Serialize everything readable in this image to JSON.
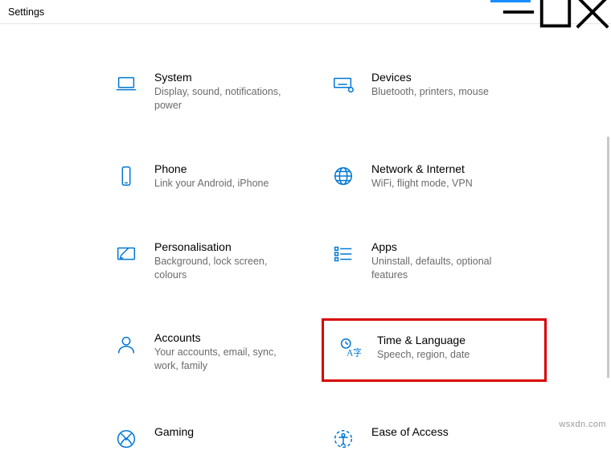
{
  "window": {
    "title": "Settings"
  },
  "categories": {
    "system": {
      "title": "System",
      "desc": "Display, sound, notifications, power"
    },
    "devices": {
      "title": "Devices",
      "desc": "Bluetooth, printers, mouse"
    },
    "phone": {
      "title": "Phone",
      "desc": "Link your Android, iPhone"
    },
    "network": {
      "title": "Network & Internet",
      "desc": "WiFi, flight mode, VPN"
    },
    "personal": {
      "title": "Personalisation",
      "desc": "Background, lock screen, colours"
    },
    "apps": {
      "title": "Apps",
      "desc": "Uninstall, defaults, optional features"
    },
    "accounts": {
      "title": "Accounts",
      "desc": "Your accounts, email, sync, work, family"
    },
    "timelang": {
      "title": "Time & Language",
      "desc": "Speech, region, date"
    },
    "gaming": {
      "title": "Gaming",
      "desc": ""
    },
    "ease": {
      "title": "Ease of Access",
      "desc": ""
    }
  },
  "watermark": "wsxdn.com"
}
